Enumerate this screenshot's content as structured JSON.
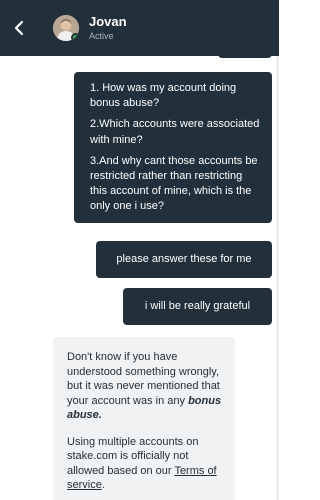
{
  "header": {
    "contact_name": "Jovan",
    "contact_status": "Active"
  },
  "messages": {
    "questions": [
      "1. How was my account doing bonus abuse?",
      "2.Which accounts were associated with mine?",
      "3.And why cant those accounts be restricted rather than restricting this account of mine, which is the only one i use?"
    ],
    "please_answer": "please answer these for me",
    "grateful": "i will be really grateful"
  },
  "reply": {
    "p1_text": "Don't know if you have understood something wrongly, but it was never mentioned that your account was in any ",
    "p1_emph": "bonus abuse.",
    "p2_text": "Using multiple accounts on stake.com is officially not allowed based on our ",
    "p2_link": "Terms of service",
    "p2_end": "."
  },
  "colors": {
    "header_bg": "#22303b",
    "outgoing_bubble": "#22303b",
    "incoming_bubble": "#f1f2f3",
    "online_dot": "#27c24c"
  }
}
